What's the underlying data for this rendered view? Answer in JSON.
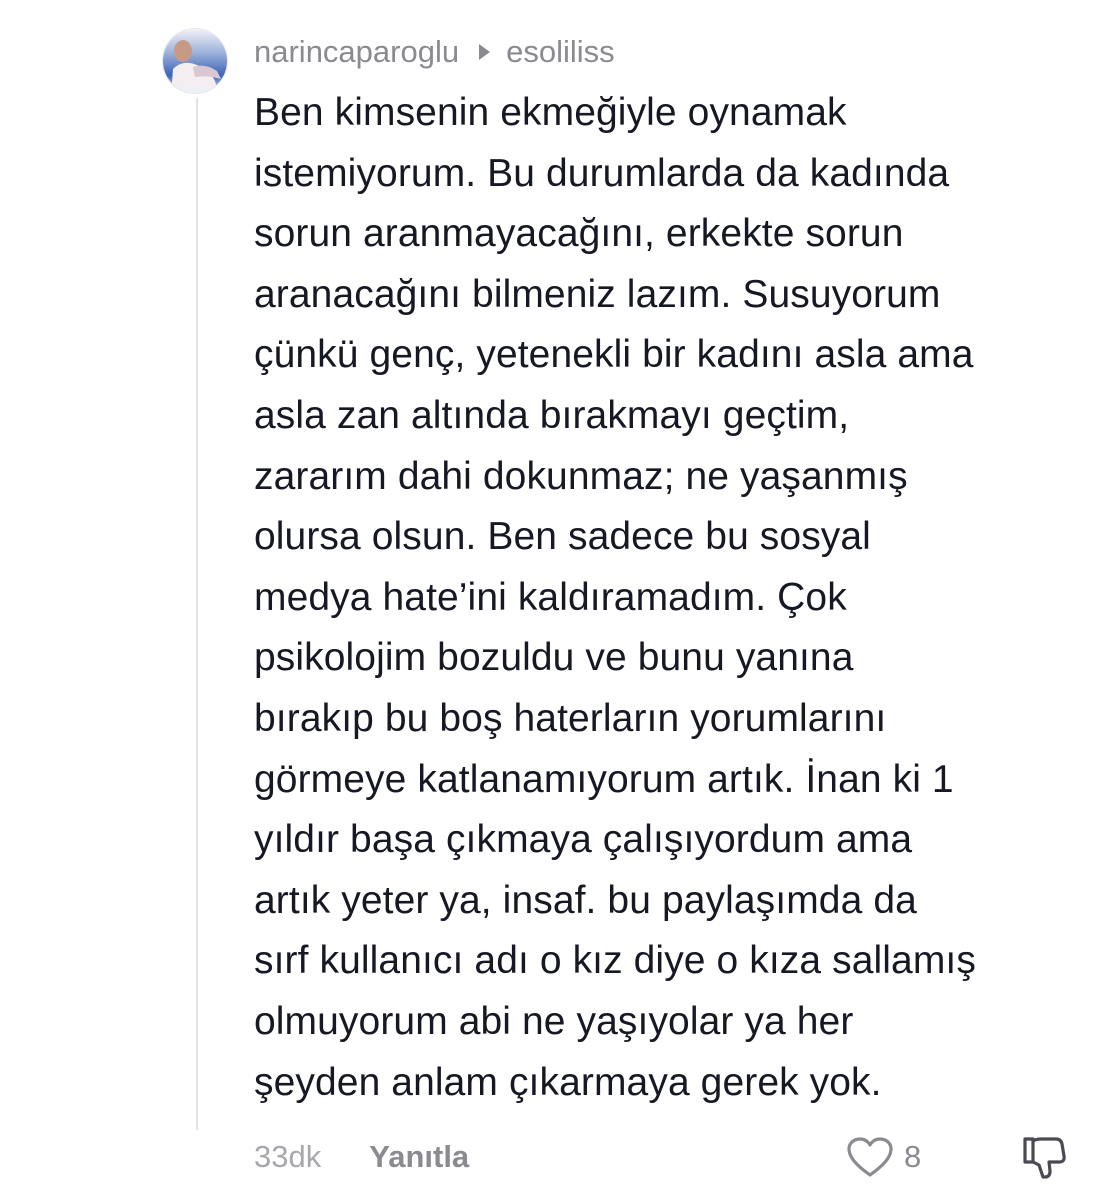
{
  "comment": {
    "username": "narincaparoglu",
    "reply_to": "esoliliss",
    "text": "Ben kimsenin ekmeğiyle oynamak\nistemiyorum. Bu durumlarda da kadında\nsorun aranmayacağını, erkekte sorun\naranacağını bilmeniz lazım. Susuyorum\nçünkü genç, yetenekli bir kadını asla ama\nasla zan altında bırakmayı geçtim,\nzararım dahi dokunmaz; ne yaşanmış\nolursa olsun. Ben sadece bu sosyal\nmedya hate’ini kaldıramadım. Çok\npsikolojim bozuldu ve bunu yanına\nbırakıp bu boş haterların yorumlarını\ngörmeye katlanamıyorum artık. İnan ki 1\nyıldır başa çıkmaya çalışıyordum ama\nartık yeter ya, insaf. bu paylaşımda da\nsırf kullanıcı adı o kız diye o kıza sallamış\nolmuyorum abi ne yaşıyolar ya her\nşeyden anlam çıkarmaya gerek yok.",
    "time": "33dk",
    "reply_label": "Yanıtla",
    "like_count": "8",
    "icons": {
      "reply_to": "caret-right-icon",
      "like": "heart-outline-icon",
      "dislike": "thumbs-down-icon"
    },
    "colors": {
      "text": "#161823",
      "secondary": "#8a8b91",
      "time": "#a7a8ac",
      "thread_line": "#e3e3e4"
    }
  }
}
